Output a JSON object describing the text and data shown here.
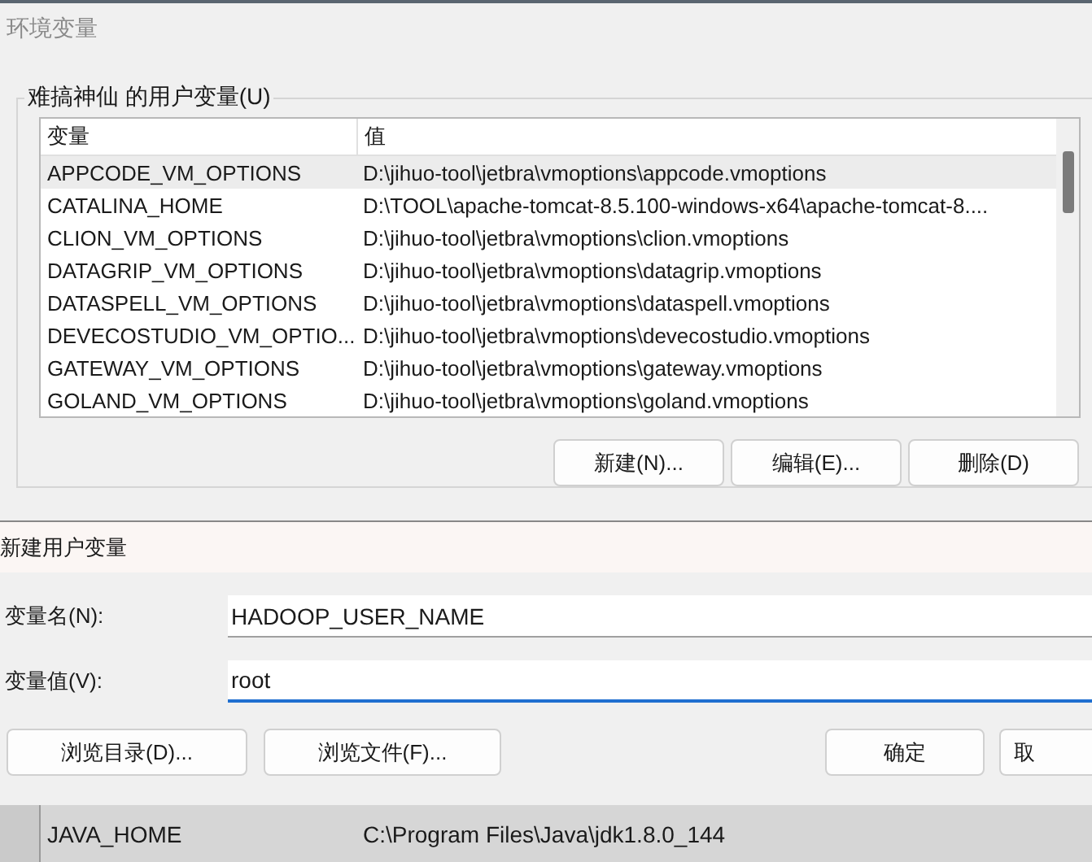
{
  "window": {
    "title": "环境变量"
  },
  "user_vars": {
    "label": "难搞神仙 的用户变量(U)",
    "columns": [
      "变量",
      "值"
    ],
    "rows": [
      {
        "name": "APPCODE_VM_OPTIONS",
        "value": "D:\\jihuo-tool\\jetbra\\vmoptions\\appcode.vmoptions",
        "selected": true
      },
      {
        "name": "CATALINA_HOME",
        "value": "D:\\TOOL\\apache-tomcat-8.5.100-windows-x64\\apache-tomcat-8....",
        "selected": false
      },
      {
        "name": "CLION_VM_OPTIONS",
        "value": "D:\\jihuo-tool\\jetbra\\vmoptions\\clion.vmoptions",
        "selected": false
      },
      {
        "name": "DATAGRIP_VM_OPTIONS",
        "value": "D:\\jihuo-tool\\jetbra\\vmoptions\\datagrip.vmoptions",
        "selected": false
      },
      {
        "name": "DATASPELL_VM_OPTIONS",
        "value": "D:\\jihuo-tool\\jetbra\\vmoptions\\dataspell.vmoptions",
        "selected": false
      },
      {
        "name": "DEVECOSTUDIO_VM_OPTIO...",
        "value": "D:\\jihuo-tool\\jetbra\\vmoptions\\devecostudio.vmoptions",
        "selected": false
      },
      {
        "name": "GATEWAY_VM_OPTIONS",
        "value": "D:\\jihuo-tool\\jetbra\\vmoptions\\gateway.vmoptions",
        "selected": false
      },
      {
        "name": "GOLAND_VM_OPTIONS",
        "value": "D:\\jihuo-tool\\jetbra\\vmoptions\\goland.vmoptions",
        "selected": false
      }
    ],
    "buttons": [
      "新建(N)...",
      "编辑(E)...",
      "删除(D)"
    ]
  },
  "new_var_dialog": {
    "title": "新建用户变量",
    "fields": [
      {
        "label": "变量名(N):",
        "value": "HADOOP_USER_NAME",
        "focused": false
      },
      {
        "label": "变量值(V):",
        "value": "root",
        "focused": true
      }
    ],
    "buttons": [
      "浏览目录(D)...",
      "浏览文件(F)...",
      "确定",
      "取"
    ]
  },
  "background_rows": [
    {
      "name": "JAVA_HOME",
      "value": "C:\\Program Files\\Java\\jdk1.8.0_144"
    }
  ]
}
